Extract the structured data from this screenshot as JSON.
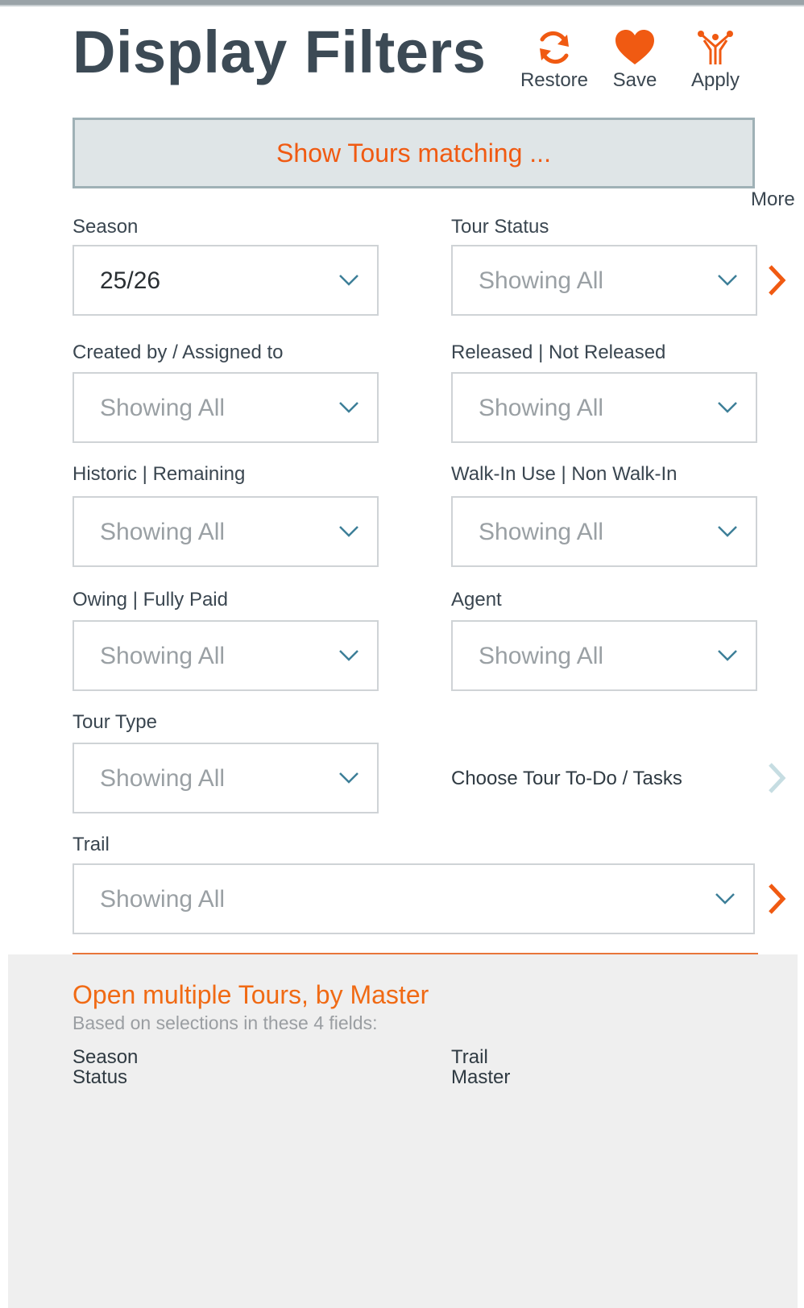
{
  "header": {
    "title": "Display Filters",
    "actions": {
      "restore": "Restore",
      "save": "Save",
      "apply": "Apply"
    }
  },
  "banner": {
    "text": "Show Tours matching ..."
  },
  "more_label": "More",
  "filters": {
    "season": {
      "label": "Season",
      "value": "25/26"
    },
    "tour_status": {
      "label": "Tour Status",
      "value": "Showing All"
    },
    "created_by": {
      "label": "Created by / Assigned to",
      "value": "Showing All"
    },
    "released": {
      "label": "Released | Not Released",
      "value": "Showing All"
    },
    "historic": {
      "label": "Historic | Remaining",
      "value": "Showing All"
    },
    "walk_in": {
      "label": "Walk-In Use | Non Walk-In",
      "value": "Showing All"
    },
    "owing": {
      "label": "Owing | Fully Paid",
      "value": "Showing All"
    },
    "agent": {
      "label": "Agent",
      "value": "Showing All"
    },
    "tour_type": {
      "label": "Tour Type",
      "value": "Showing All"
    },
    "trail": {
      "label": "Trail",
      "value": "Showing All"
    }
  },
  "tasks_link": "Choose Tour To-Do / Tasks",
  "master": {
    "title": "Open multiple Tours, by Master",
    "subtitle": "Based on selections in these 4 fields:",
    "fields": [
      "Season",
      "Status",
      "Trail",
      "Master"
    ]
  },
  "colors": {
    "accent": "#f05a12",
    "banner_bg": "#dfe5e7",
    "banner_border": "#9fb1b6",
    "title": "#3c4a55",
    "chevron": "#3d7f98",
    "muted_arrow": "#c6dde2",
    "panel_bg": "#efefef"
  },
  "icons": {
    "restore": "refresh-icon",
    "save": "heart-icon",
    "apply": "fork-icon",
    "dropdown": "chevron-down-icon",
    "navigate": "chevron-right-icon"
  }
}
